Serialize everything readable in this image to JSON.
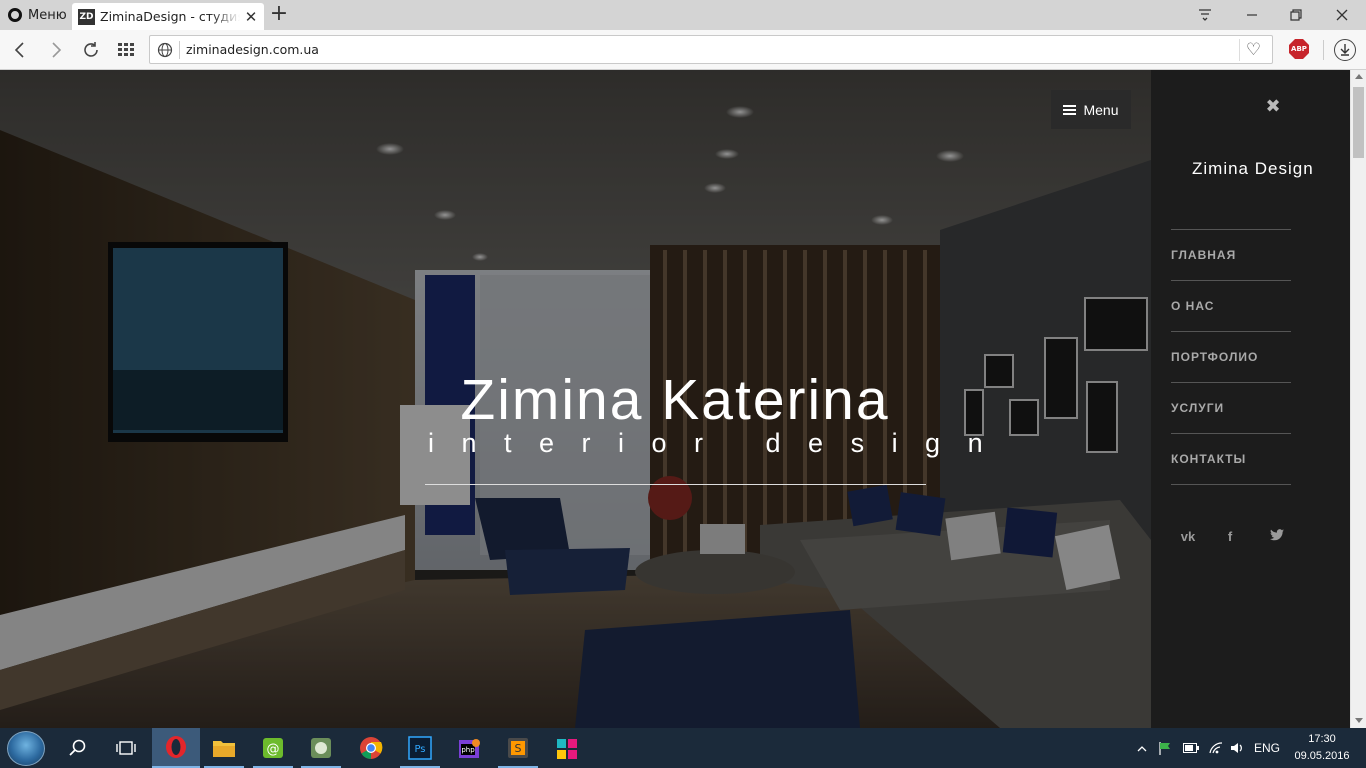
{
  "browser": {
    "menu_label": "Меню",
    "tab_favicon": "ZD",
    "tab_title": "ZiminaDesign - студия ди",
    "tab_close": "✕",
    "new_tab": "+",
    "url": "ziminadesign.com.ua",
    "abp_label": "ABP"
  },
  "page": {
    "menu_button": "Menu",
    "hero_title": "Zimina Katerina",
    "hero_subtitle": "interior design"
  },
  "panel": {
    "close": "✖",
    "brand": "Zimina Design",
    "nav": [
      "ГЛАВНАЯ",
      "О НАС",
      "ПОРТФОЛИО",
      "УСЛУГИ",
      "КОНТАКТЫ"
    ],
    "social": [
      "vk",
      "f",
      "t"
    ]
  },
  "taskbar": {
    "lang": "ENG",
    "time": "17:30",
    "date": "09.05.2016"
  }
}
